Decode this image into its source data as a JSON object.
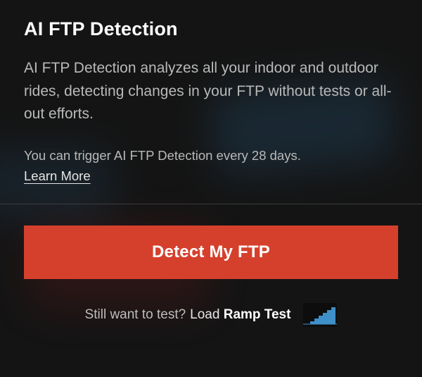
{
  "header": {
    "title": "AI FTP Detection"
  },
  "body": {
    "description": "AI FTP Detection analyzes all your indoor and outdoor rides, detecting changes in your FTP without tests or all-out efforts.",
    "note": "You can trigger AI FTP Detection every 28 days.",
    "learn_more_label": "Learn More"
  },
  "actions": {
    "primary_label": "Detect My FTP",
    "secondary_prompt": "Still want to test?",
    "secondary_load_prefix": "Load ",
    "secondary_test_name": "Ramp Test"
  },
  "colors": {
    "primary_button": "#d5402c",
    "ramp_icon_fill": "#3f8fc8"
  }
}
